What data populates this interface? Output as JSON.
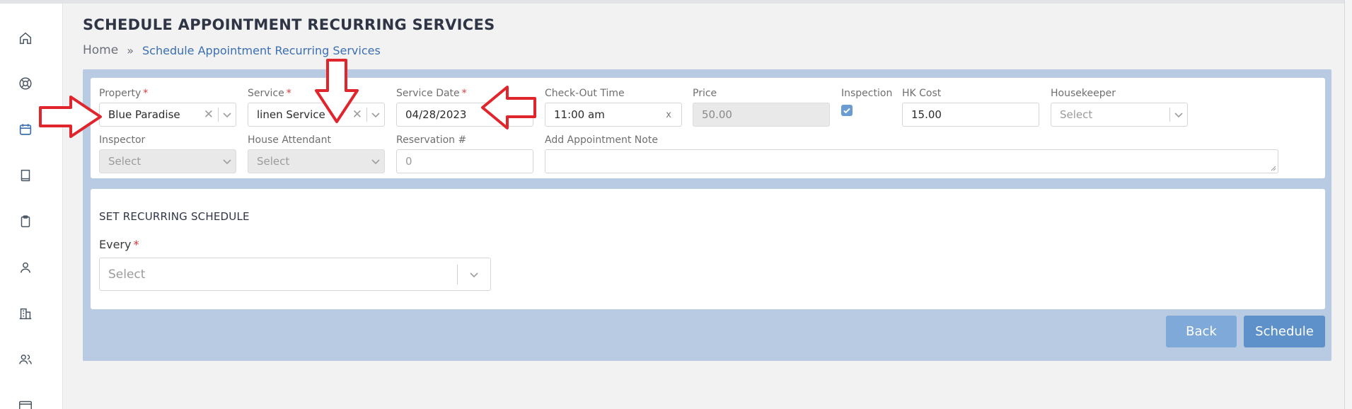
{
  "page": {
    "title": "SCHEDULE APPOINTMENT RECURRING SERVICES",
    "breadcrumb": {
      "home": "Home",
      "separator": "»",
      "current": "Schedule Appointment Recurring Services"
    }
  },
  "sidebar": {
    "items": [
      {
        "icon": "home-icon"
      },
      {
        "icon": "lifebuoy-icon"
      },
      {
        "icon": "calendar-icon",
        "active": true
      },
      {
        "icon": "book-icon"
      },
      {
        "icon": "clipboard-icon"
      },
      {
        "icon": "user-icon"
      },
      {
        "icon": "building-icon"
      },
      {
        "icon": "users-icon"
      },
      {
        "icon": "credit-card-icon"
      }
    ]
  },
  "form": {
    "property": {
      "label": "Property",
      "value": "Blue Paradise",
      "required": true
    },
    "service": {
      "label": "Service",
      "value": "linen Service",
      "required": true
    },
    "service_date": {
      "label": "Service Date",
      "value": "04/28/2023",
      "required": true
    },
    "checkout_time": {
      "label": "Check-Out Time",
      "value": "11:00 am",
      "clear": "x"
    },
    "price": {
      "label": "Price",
      "value": "50.00"
    },
    "inspection": {
      "label": "Inspection",
      "checked": true
    },
    "hk_cost": {
      "label": "HK Cost",
      "value": "15.00"
    },
    "housekeeper": {
      "label": "Housekeeper",
      "placeholder": "Select"
    },
    "inspector": {
      "label": "Inspector",
      "placeholder": "Select"
    },
    "house_attendant": {
      "label": "House Attendant",
      "placeholder": "Select"
    },
    "reservation": {
      "label": "Reservation #",
      "placeholder": "0"
    },
    "appointment_note": {
      "label": "Add Appointment Note",
      "value": ""
    }
  },
  "recurring": {
    "section_title": "SET RECURRING SCHEDULE",
    "every_label": "Every",
    "every_placeholder": "Select"
  },
  "actions": {
    "back": "Back",
    "schedule": "Schedule"
  },
  "colors": {
    "accent": "#5e91c9",
    "panel": "#b8cbe3",
    "required": "#e0343a",
    "annotation_arrow": "#e0262c"
  }
}
